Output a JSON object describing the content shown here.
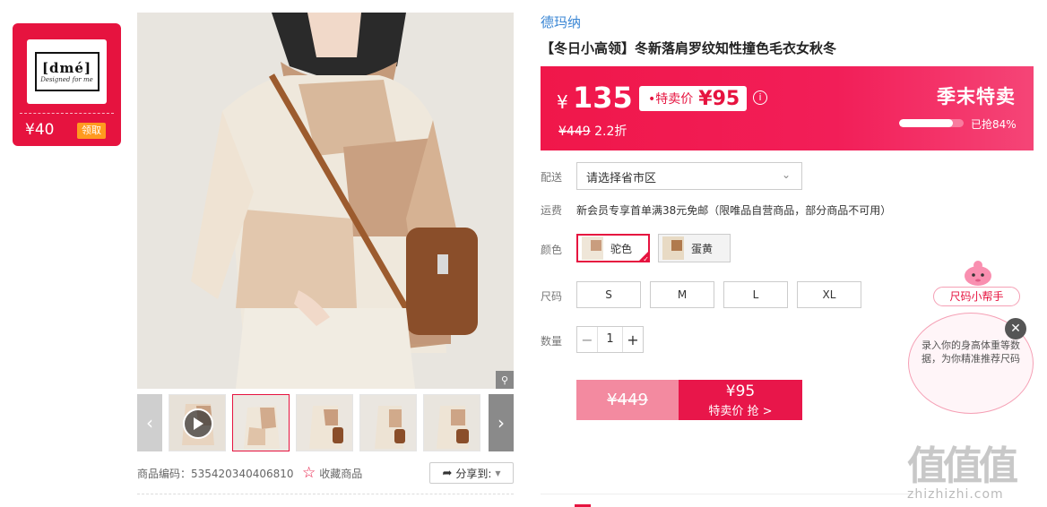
{
  "coupon": {
    "brand_logo_text": "dmé",
    "brand_logo_sub": "Designed for me",
    "amount": "¥40",
    "claim_label": "领取"
  },
  "gallery": {
    "zoom_icon": "search-icon",
    "thumbnails": [
      "video",
      "photo-2",
      "photo-3",
      "photo-4",
      "photo-5"
    ],
    "active_index": 1
  },
  "product_meta": {
    "code_label": "商品编码：535420340406810",
    "favorite_label": "收藏商品",
    "share_label": "分享到:"
  },
  "product": {
    "brand": "德玛纳",
    "title": "【冬日小高领】冬新落肩罗纹知性撞色毛衣女秋冬"
  },
  "price": {
    "yen": "¥",
    "current": "135",
    "special_label": "•特卖价",
    "special_price": "¥95",
    "original": "¥449",
    "discount": "2.2折",
    "event_title": "季末特卖",
    "sold_fraction": 0.84,
    "sold_label": "已抢84%",
    "info_icon": "info-icon"
  },
  "options": {
    "delivery_label": "配送",
    "delivery_value": "请选择省市区",
    "shipping_label": "运费",
    "shipping_text": "新会员专享首单满38元免邮（限唯品自营商品，部分商品不可用）",
    "color_label": "颜色",
    "colors": [
      "驼色",
      "蛋黄"
    ],
    "size_label": "尺码",
    "sizes": [
      "S",
      "M",
      "L",
      "XL"
    ],
    "qty_label": "数量",
    "qty_value": "1"
  },
  "buy": {
    "orig_price": "¥449",
    "price": "¥95",
    "label": "特卖价 抢 >"
  },
  "helper": {
    "tag": "尺码小帮手",
    "bubble_text": "录入你的身高体重等数据，为你精准推荐尺码"
  },
  "watermark": {
    "big": "值值值",
    "url": "zhizhizhi.com"
  },
  "colors": {
    "accent": "#e6133f",
    "brand_link": "#3a86d4"
  }
}
